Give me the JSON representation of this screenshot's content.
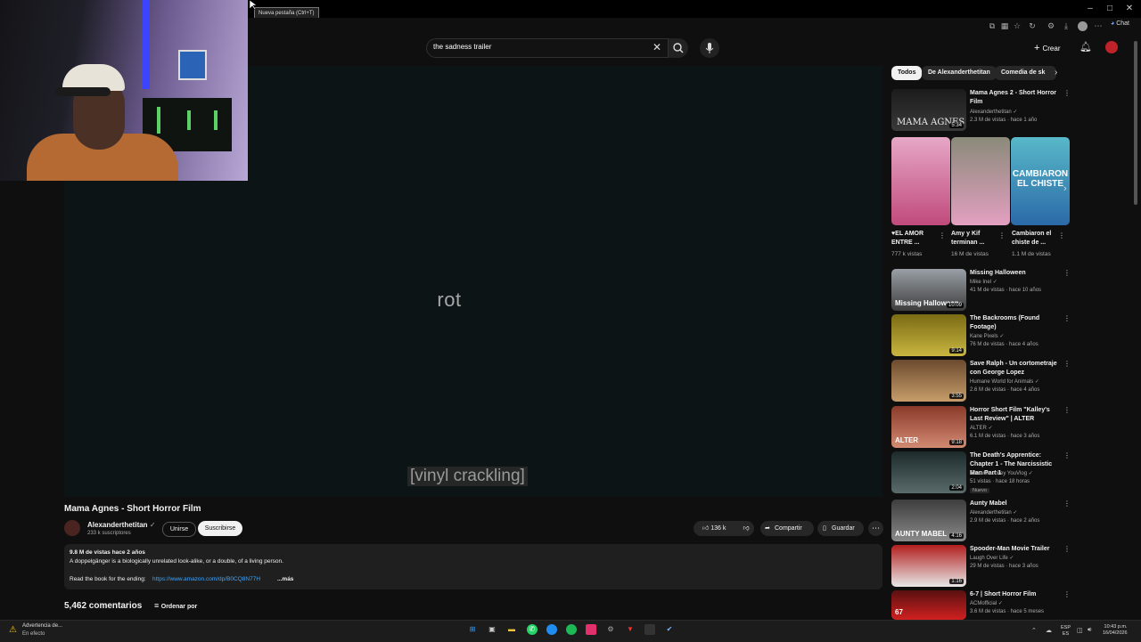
{
  "browser": {
    "tooltip": "Nueva pestaña (Ctrl+T)",
    "chat_label": "Chat",
    "window_controls": [
      "–",
      "□",
      "✕"
    ]
  },
  "header": {
    "search_value": "the sadness trailer",
    "create_label": "Crear"
  },
  "player": {
    "caption_top": "rot",
    "caption_bottom": "[vinyl crackling]"
  },
  "video": {
    "title": "Mama Agnes - Short Horror Film",
    "channel": "Alexanderthetitan",
    "subscribers": "233 k suscriptores",
    "join_label": "Unirse",
    "subscribe_label": "Suscribirse",
    "likes": "136 k",
    "share_label": "Compartir",
    "save_label": "Guardar",
    "description": {
      "stats": "9.8 M de vistas  hace 2 años",
      "line1": "A doppelgänger is a biologically unrelated look-alike, or a double, of a living person.",
      "line2_prefix": "Read the book for the ending:",
      "link": "https://www.amazon.com/dp/B0CQ8N77H",
      "more": "...más"
    },
    "comments_count": "5,462 comentarios",
    "sort_label": "Ordenar por"
  },
  "sidebar": {
    "chips": [
      "Todos",
      "De Alexanderthetitan",
      "Comedia de sk"
    ],
    "recommendations_top": [
      {
        "title": "Mama Agnes 2 - Short Horror Film",
        "channel": "Alexanderthetitan",
        "meta": "2.3 M de vistas · hace 1 año",
        "duration": "5:34",
        "thumb_text": "MAMA AGNES"
      }
    ],
    "shorts": [
      {
        "title": "♥EL AMOR ENTRE ...",
        "views": "777 k vistas"
      },
      {
        "title": "Amy y Kif terminan ...",
        "views": "16 M de vistas"
      },
      {
        "title": "Cambiaron el chiste de ...",
        "views": "1.1 M de vistas",
        "thumb_text": "CAMBIARON EL CHISTE"
      }
    ],
    "recommendations": [
      {
        "title": "Missing Halloween",
        "channel": "Mike Inel",
        "meta": "41 M de vistas · hace 10 años",
        "duration": "10:09",
        "thumb_text": "Missing Halloween",
        "lines": 1
      },
      {
        "title": "The Backrooms (Found Footage)",
        "channel": "Kane Pixels",
        "meta": "76 M de vistas · hace 4 años",
        "duration": "9:14",
        "lines": 2
      },
      {
        "title": "Save Ralph - Un cortometraje con George Lopez",
        "channel": "Humane World for Animals",
        "meta": "2.6 M de vistas · hace 4 años",
        "duration": "3:55",
        "lines": 2
      },
      {
        "title": "Horror Short Film \"Kalley's Last Review\" | ALTER",
        "channel": "ALTER",
        "meta": "6.1 M de vistas · hace 3 años",
        "duration": "9:18",
        "thumb_text": "ALTER",
        "lines": 2
      },
      {
        "title": "The Death's Apprentice: Chapter 1 - The Narcissistic Man Part 1",
        "channel": "Theowlmonkey YouVlog",
        "meta": "51 vistas · hace 18 horas",
        "duration": "2:04",
        "badge": "Nuevo",
        "lines": 2
      },
      {
        "title": "Aunty Mabel",
        "channel": "Alexanderthetitan",
        "meta": "2.9 M de vistas · hace 2 años",
        "duration": "4:16",
        "thumb_text": "AUNTY MABEL",
        "lines": 1
      },
      {
        "title": "Spooder-Man Movie Trailer",
        "channel": "Laugh Over Life",
        "meta": "29 M de vistas · hace 3 años",
        "duration": "1:16",
        "lines": 1
      },
      {
        "title": "6-7 | Short Horror Film",
        "channel": "ACMofficial",
        "meta": "3.6 M de vistas · hace 5 meses",
        "duration": "",
        "thumb_text": "67",
        "lines": 1
      }
    ]
  },
  "taskbar": {
    "warning_title": "Advertencia de...",
    "warning_sub": "En efecto",
    "lang_top": "ESP",
    "lang_bottom": "ES",
    "time": "10:43 p.m.",
    "date": "16/04/2026"
  }
}
